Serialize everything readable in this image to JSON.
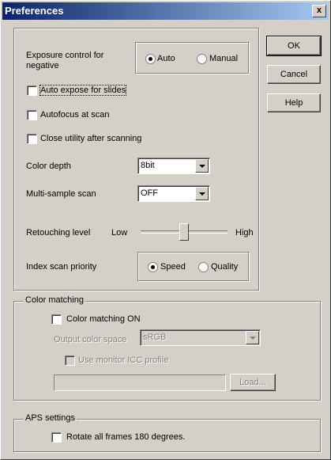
{
  "window": {
    "title": "Preferences",
    "close_label": "x"
  },
  "buttons": {
    "ok": "OK",
    "cancel": "Cancel",
    "help": "Help",
    "load": "Load..."
  },
  "exposure": {
    "label": "Exposure control for negative",
    "auto": "Auto",
    "manual": "Manual",
    "selected": "Auto"
  },
  "checks": {
    "auto_expose": {
      "label": "Auto expose for slides",
      "checked": false
    },
    "autofocus": {
      "label": "Autofocus at scan",
      "checked": false
    },
    "close_utility": {
      "label": "Close utility after scanning",
      "checked": false
    }
  },
  "color_depth": {
    "label": "Color depth",
    "value": "8bit"
  },
  "multi_sample": {
    "label": "Multi-sample scan",
    "value": "OFF"
  },
  "retouching": {
    "label": "Retouching level",
    "low": "Low",
    "high": "High",
    "level": 0.33
  },
  "index_scan": {
    "label": "Index scan priority",
    "speed": "Speed",
    "quality": "Quality",
    "selected": "Speed"
  },
  "color_matching": {
    "group_label": "Color matching",
    "on_label": "Color matching ON",
    "output_label": "Output color space",
    "output_value": "sRGB",
    "monitor_label": "Use monitor ICC profile",
    "icc_path": ""
  },
  "aps": {
    "group_label": "APS settings",
    "rotate_label": "Rotate all frames 180 degrees."
  }
}
